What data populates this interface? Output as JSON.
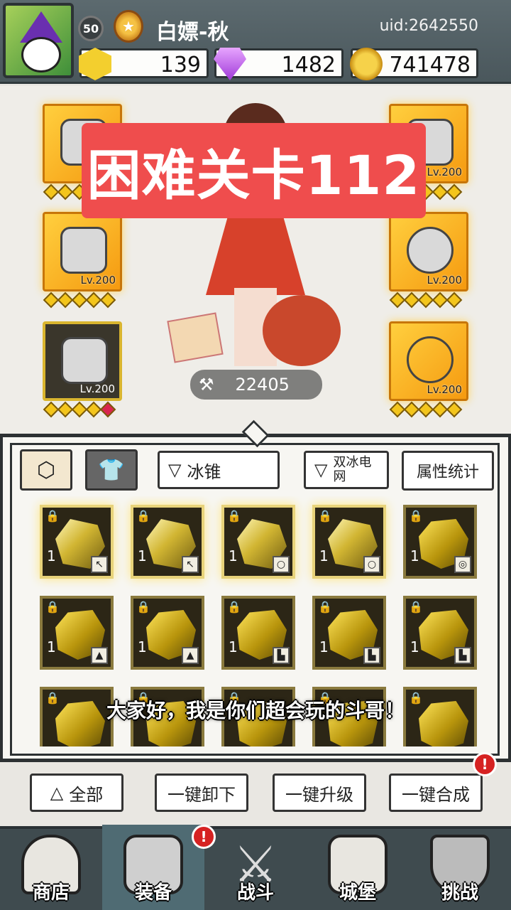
{
  "player": {
    "level": "50",
    "name": "白嫖-秋",
    "uid": "uid:2642550"
  },
  "resources": {
    "gold": "139",
    "gems": "1482",
    "coins": "741478"
  },
  "banner": {
    "text": "困难关卡112"
  },
  "equipment": {
    "left": [
      {
        "level": ""
      },
      {
        "level": "Lv.200"
      },
      {
        "level": "Lv.200"
      }
    ],
    "right": [
      {
        "level": "Lv.200"
      },
      {
        "level": "Lv.200"
      },
      {
        "level": "Lv.200"
      }
    ]
  },
  "hero": {
    "power": "22405"
  },
  "inventory": {
    "filter1": "冰锥",
    "filter2": "双冰电网",
    "stats_button": "属性统计",
    "items": [
      {
        "count": "1",
        "type": "weapon"
      },
      {
        "count": "1",
        "type": "weapon"
      },
      {
        "count": "1",
        "type": "necklace"
      },
      {
        "count": "1",
        "type": "necklace"
      },
      {
        "count": "1",
        "type": "ring"
      },
      {
        "count": "1",
        "type": "armor"
      },
      {
        "count": "1",
        "type": "armor"
      },
      {
        "count": "1",
        "type": "boots"
      },
      {
        "count": "1",
        "type": "boots"
      },
      {
        "count": "1",
        "type": "boots"
      },
      {
        "count": "",
        "type": ""
      },
      {
        "count": "",
        "type": ""
      },
      {
        "count": "",
        "type": ""
      },
      {
        "count": "",
        "type": ""
      },
      {
        "count": "",
        "type": ""
      }
    ]
  },
  "subtitle": "大家好，我是你们超会玩的斗哥！",
  "actions": {
    "all": "全部",
    "unequip": "一键卸下",
    "upgrade": "一键升级",
    "merge": "一键合成",
    "notif": "!"
  },
  "nav": {
    "shop": "商店",
    "equipment": "装备",
    "battle": "战斗",
    "castle": "城堡",
    "challenge": "挑战",
    "notif": "!"
  },
  "colors": {
    "banner": "#ef4d4d",
    "slot_orange": "#f59a10",
    "nav_bg": "#3f4b4f",
    "nav_active": "#4f6b73",
    "notif_red": "#d62222"
  }
}
